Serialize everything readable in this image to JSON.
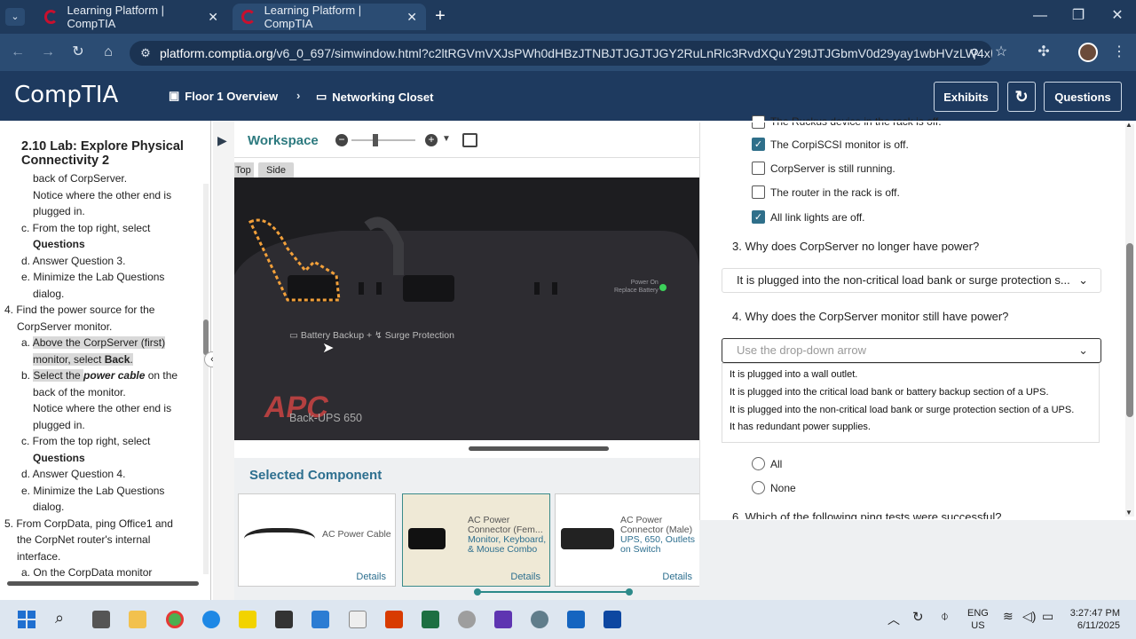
{
  "browser": {
    "tabs": [
      {
        "title": "Learning Platform | CompTIA",
        "close": "✕"
      },
      {
        "title": "Learning Platform | CompTIA",
        "close": "✕"
      }
    ],
    "new_tab": "+",
    "url_domain": "platform.comptia.org",
    "url_path": "/v6_0_697/simwindow.html?c2ltRGVmVXJsPWh0dHBzJTNBJTJGJTJGY2RuLnRlc3RvdXQuY29tJTJGbmV0d29yay1wbHVzLW4xMC0wMD..."
  },
  "header": {
    "logo": "CompTIA",
    "crumb1": "Floor 1 Overview",
    "crumb2": "Networking Closet",
    "exhibits": "Exhibits",
    "questions": "Questions"
  },
  "lab": {
    "title": "2.10 Lab: Explore Physical Connectivity 2",
    "s0a": "back of CorpServer.",
    "s0b": "Notice where the other end is",
    "s0c": "plugged in.",
    "s0d_pre": "c. From the top right, select",
    "s0d_b": "Questions",
    "s0e": "d. Answer Question 3.",
    "s0f": "e. Minimize the Lab Questions",
    "s0g": "dialog.",
    "s4a": "4. Find the power source for the",
    "s4b": "CorpServer monitor.",
    "s4c": "Above the CorpServer (first)",
    "s4d_pre": "monitor, select ",
    "s4d_b": "Back",
    "s4e_pre": "Select the ",
    "s4e_i": "power cable",
    "s4e_post": " on the",
    "s4f": "back of the monitor.",
    "s4g": "Notice where the other end is",
    "s4h": "plugged in.",
    "s4i": "c. From the top right, select",
    "s4j_b": "Questions",
    "s4k": "d. Answer Question 4.",
    "s4l": "e. Minimize the Lab Questions",
    "s4m": "dialog.",
    "s5a": "5. From CorpData, ping Office1 and",
    "s5b": "the CorpNet router's internal",
    "s5c": "interface.",
    "s5d": "a. On the CorpData monitor"
  },
  "workspace": {
    "title": "Workspace",
    "view_top": "Top",
    "view_side": "Side",
    "ups_label": "Back-UPS 650",
    "battery_label": "▭ Battery Backup + ↯ Surge Protection",
    "power_on": "Power On",
    "replace_battery": "Replace Battery",
    "apc": "APC"
  },
  "selected": {
    "title": "Selected Component",
    "details": "Details",
    "c1": "AC Power Cable",
    "c2a": "AC Power",
    "c2b": "Connector (Fem...",
    "c2c": "Monitor, Keyboard,",
    "c2d": "& Mouse Combo",
    "c3a": "AC Power",
    "c3b": "Connector (Male)",
    "c3c": "UPS, 650, Outlets",
    "c3d": "on Switch"
  },
  "questions": {
    "cb0": "The Ruckus device in the rack is off.",
    "cb1": "The CorpiSCSI monitor is off.",
    "cb2": "CorpServer is still running.",
    "cb3": "The router in the rack is off.",
    "cb4": "All link lights are off.",
    "q3": "3. Why does CorpServer no longer have power?",
    "q3_answer": "It is plugged into the non-critical load bank or surge protection s...",
    "q4": "4. Why does the CorpServer monitor still have power?",
    "q4_placeholder": "Use the drop-down arrow",
    "opt1": "It is plugged into a wall outlet.",
    "opt2": "It is plugged into the critical load bank or battery backup section of a UPS.",
    "opt3": "It is plugged into the non-critical load bank or surge protection section of a UPS.",
    "opt4": "It has redundant power supplies.",
    "r_all": "All",
    "r_none": "None",
    "q6": "6. Which of the following ping tests were successful?"
  },
  "taskbar": {
    "lang1": "ENG",
    "lang2": "US",
    "time": "3:27:47 PM",
    "date": "6/11/2025"
  }
}
